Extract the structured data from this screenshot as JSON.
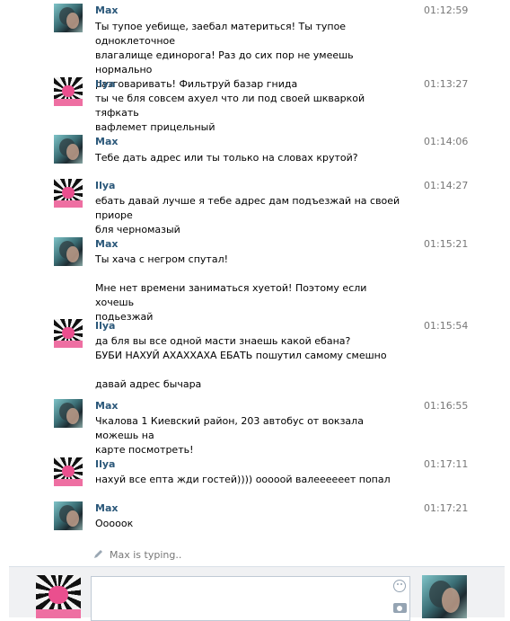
{
  "messages": [
    {
      "author": "Max",
      "time": "01:12:59",
      "avatar": "max",
      "lines": [
        "Ты тупое уебище, заебал материться! Ты тупое одноклеточное",
        "влагалище единорога! Раз до сих пор не умеешь нормально",
        "разговаривать! Фильтруй базар гнида"
      ]
    },
    {
      "author": "Ilya",
      "time": "01:13:27",
      "avatar": "ilya",
      "lines": [
        "ты че бля совсем ахуел что ли под своей шкваркой тяфкать",
        "вафлемет прицельный"
      ]
    },
    {
      "author": "Max",
      "time": "01:14:06",
      "avatar": "max",
      "lines": [
        "Тебе дать адрес или ты только на словах крутой?"
      ]
    },
    {
      "author": "Ilya",
      "time": "01:14:27",
      "avatar": "ilya",
      "lines": [
        "ебать давай лучше я тебе адрес дам подъезжай на своей приоре",
        "бля черномазый"
      ]
    },
    {
      "author": "Max",
      "time": "01:15:21",
      "avatar": "max",
      "lines": [
        "Ты хача с негром спутал!",
        "",
        "Мне нет времени заниматься хуетой! Поэтому если хочешь",
        "подьезжай"
      ]
    },
    {
      "author": "Ilya",
      "time": "01:15:54",
      "avatar": "ilya",
      "lines": [
        "да бля вы все одной масти знаешь какой ебана?",
        "БУБИ НАХУЙ АХАХХАХА ЕБАТЬ пошутил самому смешно",
        "",
        "давай адрес бычара"
      ]
    },
    {
      "author": "Max",
      "time": "01:16:55",
      "avatar": "max",
      "lines": [
        "Чкалова 1 Киевский район, 203 автобус от вокзала можешь на",
        "карте посмотреть!"
      ]
    },
    {
      "author": "Ilya",
      "time": "01:17:11",
      "avatar": "ilya",
      "lines": [
        "нахуй все епта жди гостей)))) ооооой валееееeет попал"
      ]
    },
    {
      "author": "Max",
      "time": "01:17:21",
      "avatar": "max",
      "lines": [
        "Ооооок"
      ]
    }
  ],
  "typing": {
    "text": "Max is typing..",
    "icon": "pencil-icon"
  },
  "composer": {
    "input_value": "",
    "emoji_icon": "smiley-icon",
    "attach_icon": "camera-icon"
  }
}
